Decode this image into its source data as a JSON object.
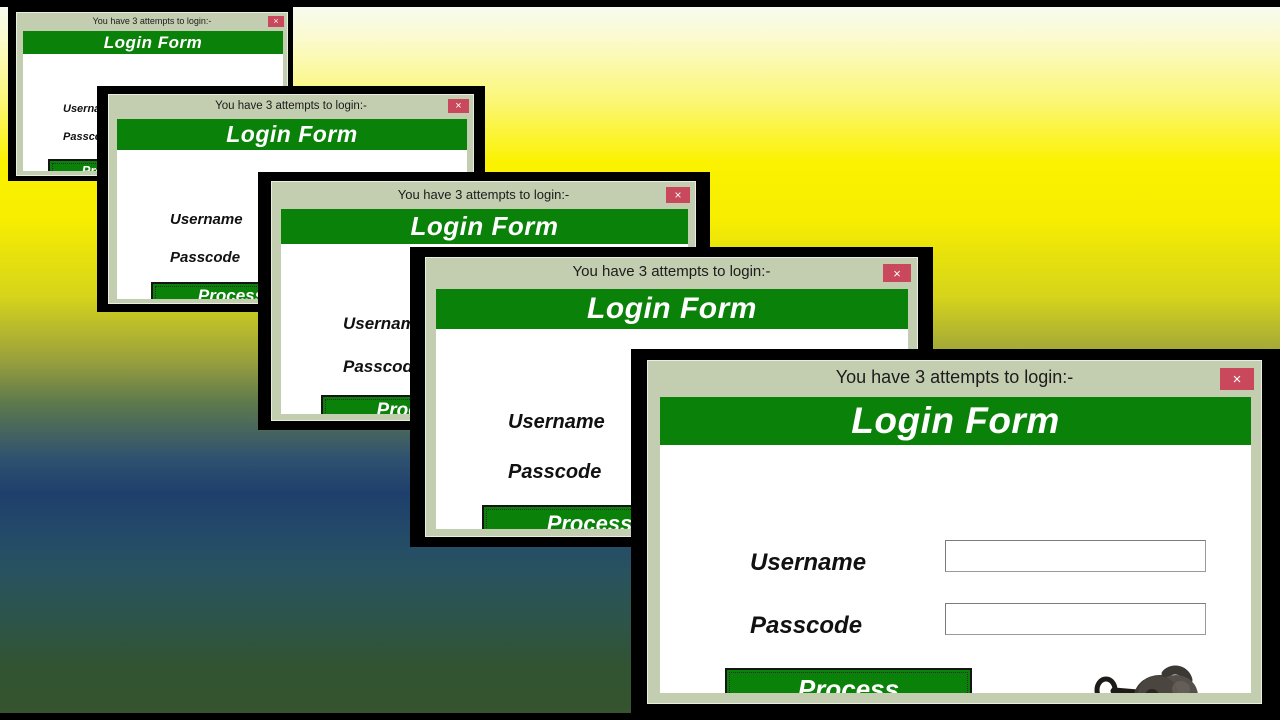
{
  "window": {
    "title": "You have 3 attempts to login:-",
    "close_label": "×"
  },
  "form": {
    "header": "Login Form",
    "username_label": "Username",
    "passcode_label": "Passcode",
    "username_value": "",
    "passcode_value": "",
    "process_label": "Process",
    "lock_icon_name": "padlock-and-key-icon"
  },
  "colors": {
    "window_chrome": "#c3cdb0",
    "header_green": "#0a8209",
    "close_red": "#c9485b",
    "body_white": "#ffffff",
    "label_black": "#111111",
    "frame_black": "#000000"
  },
  "instances": [
    {
      "id": "dlg1",
      "note": "smallest, top-left, partially offscreen"
    },
    {
      "id": "dlg2",
      "note": "second"
    },
    {
      "id": "dlg3",
      "note": "third"
    },
    {
      "id": "dlg4",
      "note": "fourth"
    },
    {
      "id": "dlg5",
      "note": "largest, front, bottom-right"
    }
  ]
}
